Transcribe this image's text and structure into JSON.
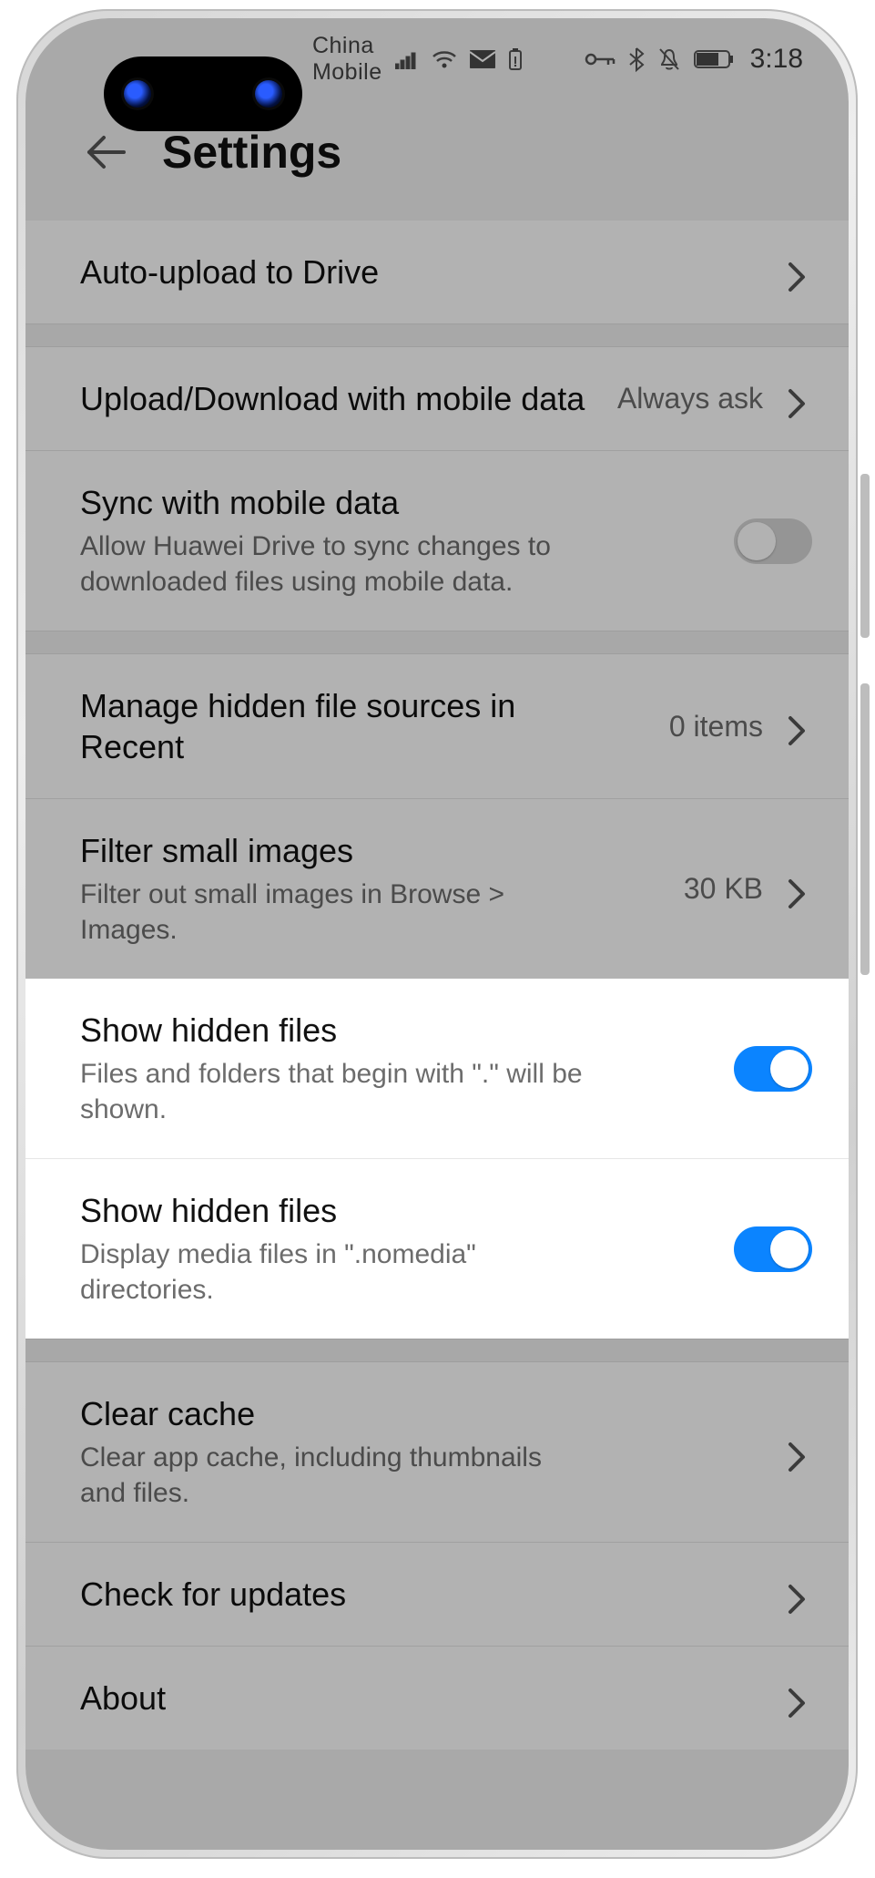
{
  "statusbar": {
    "carrier": "China Mobile",
    "time": "3:18"
  },
  "header": {
    "title": "Settings"
  },
  "rows": {
    "auto_upload": {
      "title": "Auto-upload to Drive"
    },
    "mobile_data_ul": {
      "title": "Upload/Download with mobile data",
      "value": "Always ask"
    },
    "sync_mobile": {
      "title": "Sync with mobile data",
      "sub": "Allow Huawei Drive to sync changes to downloaded files using mobile data."
    },
    "hidden_sources": {
      "title": "Manage hidden file sources in Recent",
      "value": "0 items"
    },
    "filter_small": {
      "title": "Filter small images",
      "sub": "Filter out small images in Browse > Images.",
      "value": "30 KB"
    },
    "show_hidden_dot": {
      "title": "Show hidden files",
      "sub": "Files and folders that begin with \".\" will be shown."
    },
    "show_hidden_nom": {
      "title": "Show hidden files",
      "sub": "Display media files in \".nomedia\" directories."
    },
    "clear_cache": {
      "title": "Clear cache",
      "sub": "Clear app cache, including thumbnails and files."
    },
    "check_updates": {
      "title": "Check for updates"
    },
    "about": {
      "title": "About"
    }
  }
}
